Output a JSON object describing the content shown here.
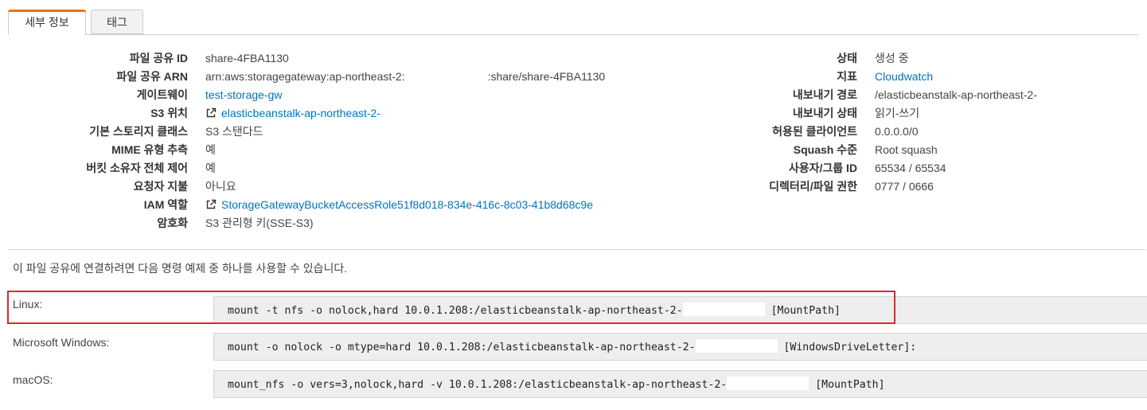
{
  "tabs": [
    {
      "label": "세부 정보",
      "active": true
    },
    {
      "label": "태그",
      "active": false
    }
  ],
  "left_fields": [
    {
      "label": "파일 공유 ID",
      "value": "share-4FBA1130",
      "type": "text"
    },
    {
      "label": "파일 공유 ARN",
      "value_prefix": "arn:aws:storagegateway:ap-northeast-2:",
      "value_suffix": ":share/share-4FBA1130",
      "type": "masked"
    },
    {
      "label": "게이트웨이",
      "value": "test-storage-gw",
      "type": "link"
    },
    {
      "label": "S3 위치",
      "value": "elasticbeanstalk-ap-northeast-2-",
      "type": "ext-link",
      "icon": "external-link-icon"
    },
    {
      "label": "기본 스토리지 클래스",
      "value": "S3 스탠다드",
      "type": "text"
    },
    {
      "label": "MIME 유형 추측",
      "value": "예",
      "type": "text"
    },
    {
      "label": "버킷 소유자 전체 제어",
      "value": "예",
      "type": "text"
    },
    {
      "label": "요청자 지불",
      "value": "아니요",
      "type": "text"
    },
    {
      "label": "IAM 역할",
      "value": "StorageGatewayBucketAccessRole51f8d018-834e-416c-8c03-41b8d68c9e",
      "type": "ext-link",
      "icon": "external-link-icon"
    },
    {
      "label": "암호화",
      "value": "S3 관리형 키(SSE-S3)",
      "type": "text"
    }
  ],
  "right_fields": [
    {
      "label": "상태",
      "value": "생성 중",
      "type": "text"
    },
    {
      "label": "지표",
      "value": "Cloudwatch",
      "type": "link"
    },
    {
      "label": "내보내기 경로",
      "value": "/elasticbeanstalk-ap-northeast-2-",
      "type": "text"
    },
    {
      "label": "내보내기 상태",
      "value": "읽기-쓰기",
      "type": "text"
    },
    {
      "label": "허용된 클라이언트",
      "value": "0.0.0.0/0",
      "type": "text"
    },
    {
      "label": "Squash 수준",
      "value": "Root squash",
      "type": "text"
    },
    {
      "label": "사용자/그룹 ID",
      "value": "65534 / 65534",
      "type": "text"
    },
    {
      "label": "디렉터리/파일 권한",
      "value": "0777 / 0666",
      "type": "text"
    }
  ],
  "note": "이 파일 공유에 연결하려면 다음 명령 예제 중 하나를 사용할 수 있습니다.",
  "commands": [
    {
      "os": "Linux:",
      "prefix": "mount -t nfs -o nolock,hard 10.0.1.208:/elasticbeanstalk-ap-northeast-2-",
      "suffix": "[MountPath]",
      "highlighted": true
    },
    {
      "os": "Microsoft Windows:",
      "prefix": "mount -o nolock -o mtype=hard 10.0.1.208:/elasticbeanstalk-ap-northeast-2-",
      "suffix": "[WindowsDriveLetter]:",
      "highlighted": false
    },
    {
      "os": "macOS:",
      "prefix": "mount_nfs -o vers=3,nolock,hard -v 10.0.1.208:/elasticbeanstalk-ap-northeast-2-",
      "suffix": "[MountPath]",
      "highlighted": false
    }
  ],
  "colors": {
    "accent_tab": "#ec7211",
    "link": "#0073bb",
    "highlight_border": "#e0282e"
  }
}
